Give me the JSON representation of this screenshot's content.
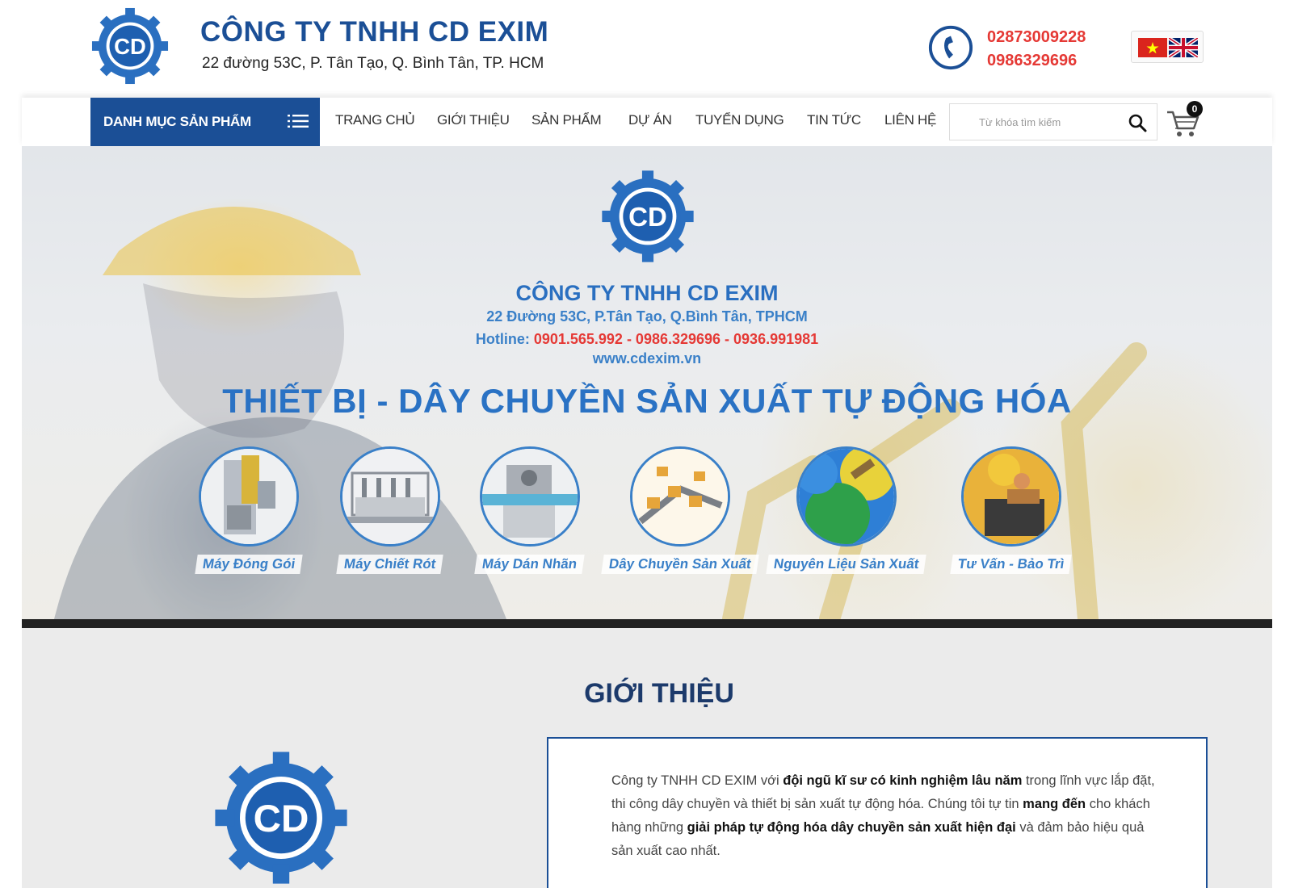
{
  "header": {
    "company_name": "CÔNG TY TNHH CD EXIM",
    "address": "22 đường 53C, P. Tân Tạo, Q. Bình Tân, TP. HCM",
    "phones": [
      "02873009228",
      "0986329696"
    ],
    "logo_text": "CD"
  },
  "nav": {
    "category_button": "DANH MỤC SẢN PHẨM",
    "links": [
      "TRANG CHỦ",
      "GIỚI THIỆU",
      "SẢN PHẨM",
      "DỰ ÁN",
      "TUYỂN DỤNG",
      "TIN TỨC",
      "LIÊN HỆ"
    ],
    "search_placeholder": "Từ khóa tìm kiếm",
    "cart_count": "0"
  },
  "hero": {
    "company": "CÔNG TY TNHH CD EXIM",
    "address": "22 Đường 53C, P.Tân Tạo, Q.Bình Tân, TPHCM",
    "hotline_label": "Hotline: ",
    "hotline_numbers": "0901.565.992 - 0986.329696 - 0936.991981",
    "website": "www.cdexim.vn",
    "slogan": "THIẾT BỊ - DÂY CHUYỀN SẢN XUẤT TỰ ĐỘNG HÓA",
    "categories": [
      {
        "label": "Máy Đóng Gói",
        "icon": "packing-machine-icon"
      },
      {
        "label": "Máy Chiết Rót",
        "icon": "filling-machine-icon"
      },
      {
        "label": "Máy Dán Nhãn",
        "icon": "labeling-machine-icon"
      },
      {
        "label": "Dây Chuyền Sản Xuất",
        "icon": "production-line-icon"
      },
      {
        "label": "Nguyên Liệu Sản Xuất",
        "icon": "plastic-pellets-icon"
      },
      {
        "label": "Tư Vấn - Bảo Trì",
        "icon": "maintenance-icon"
      }
    ]
  },
  "intro": {
    "title": "GIỚI THIỆU",
    "p1_a": "Công ty TNHH CD EXIM với ",
    "p1_b": "đội ngũ kĩ sư có kinh nghiệm lâu năm",
    "p1_c": " trong lĩnh vực lắp đặt, thi công dây chuyền và thiết bị sản xuất tự động hóa. Chúng tôi tự tin ",
    "p1_d": "mang đến",
    "p1_e": " cho khách hàng những ",
    "p1_f": "giải pháp tự động hóa dây chuyền sản xuất hiện đại",
    "p1_g": " và đảm bảo hiệu quả sản xuất cao nhất."
  },
  "colors": {
    "brand_blue": "#1b4f96",
    "accent_blue": "#2a72c4",
    "hotline_red": "#e53935"
  }
}
